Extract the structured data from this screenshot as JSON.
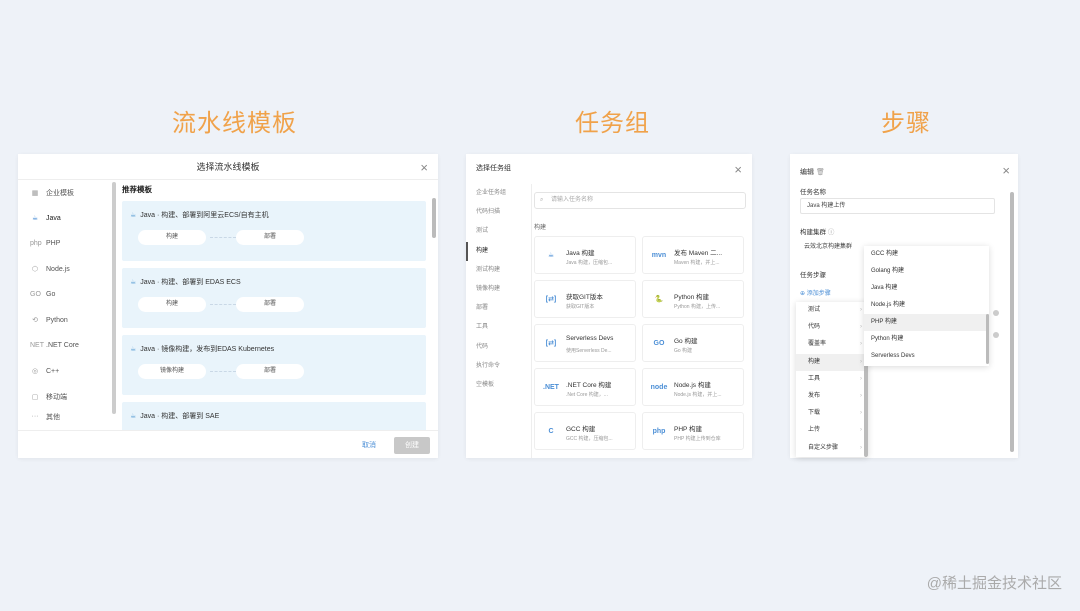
{
  "section_titles": {
    "template": "流水线模板",
    "taskgroup": "任务组",
    "step": "步骤"
  },
  "watermark": "@稀土掘金技术社区",
  "p1": {
    "title": "选择流水线模板",
    "close": "×",
    "sidebar": [
      {
        "icon": "▦",
        "label": "企业模板"
      },
      {
        "icon": "☕",
        "label": "Java"
      },
      {
        "icon": "php",
        "label": "PHP"
      },
      {
        "icon": "⬡",
        "label": "Node.js"
      },
      {
        "icon": "GO",
        "label": "Go"
      },
      {
        "icon": "⟲",
        "label": "Python"
      },
      {
        "icon": "NET",
        "label": ".NET Core"
      },
      {
        "icon": "◎",
        "label": "C++"
      },
      {
        "icon": "▢",
        "label": "移动端"
      },
      {
        "icon": "···",
        "label": "其他"
      }
    ],
    "recommend": "推荐模板",
    "cards": [
      {
        "title": "Java · 构建、部署到阿里云ECS/自有主机",
        "left": "构建",
        "right": "部署"
      },
      {
        "title": "Java · 构建、部署到 EDAS ECS",
        "left": "构建",
        "right": "部署"
      },
      {
        "title": "Java · 镜像构建，发布到EDAS Kubernetes",
        "left": "镜像构建",
        "right": "部署"
      },
      {
        "title": "Java · 构建、部署到 SAE",
        "left": "",
        "right": ""
      }
    ],
    "cancel": "取消",
    "create": "创建"
  },
  "p2": {
    "title": "选择任务组",
    "close": "×",
    "sidebar": [
      "企业任务组",
      "代码扫描",
      "测试",
      "构建",
      "测试构建",
      "镜像构建",
      "部署",
      "工具",
      "代码",
      "执行命令",
      "空模板"
    ],
    "search_placeholder": "请输入任务名称",
    "group": "构建",
    "tiles": [
      {
        "icon": "☕",
        "name": "Java 构建",
        "desc": "Java 构建，压缩包..."
      },
      {
        "icon": "mvn",
        "name": "发布 Maven 二...",
        "desc": "Maven 构建，并上..."
      },
      {
        "icon": "[⇄]",
        "name": "获取GIT版本",
        "desc": "获取GIT版本"
      },
      {
        "icon": "🐍",
        "name": "Python 构建",
        "desc": "Python 构建，上传..."
      },
      {
        "icon": "[⇄]",
        "name": "Serverless Devs",
        "desc": "使用Serverless De..."
      },
      {
        "icon": "GO",
        "name": "Go 构建",
        "desc": "Go 构建"
      },
      {
        "icon": ".NET",
        "name": ".NET Core 构建",
        "desc": ".Net Core 构建，..."
      },
      {
        "icon": "node",
        "name": "Node.js 构建",
        "desc": "Node.js 构建，并上..."
      },
      {
        "icon": "C",
        "name": "GCC 构建",
        "desc": "GCC 构建，压缩包..."
      },
      {
        "icon": "php",
        "name": "PHP 构建",
        "desc": "PHP 构建上传到仓库"
      }
    ]
  },
  "p3": {
    "title": "编辑",
    "trash": "🗑",
    "close": "×",
    "task_name_label": "任务名称",
    "task_name_value": "Java 构建上传",
    "cluster_label": "构建集群",
    "cluster_info": "ⓘ",
    "cluster_value": "云效北京构建集群",
    "steps_label": "任务步骤",
    "add_step": "⊕ 添加步骤",
    "menu1": [
      "测试",
      "代码",
      "覆盖率",
      "构建",
      "工具",
      "发布",
      "下载",
      "上传",
      "自定义步骤"
    ],
    "menu2": [
      "GCC 构建",
      "Golang 构建",
      "Java 构建",
      "Node.js 构建",
      "PHP 构建",
      "Python 构建",
      "Serverless Devs"
    ],
    "chevron": "›"
  }
}
